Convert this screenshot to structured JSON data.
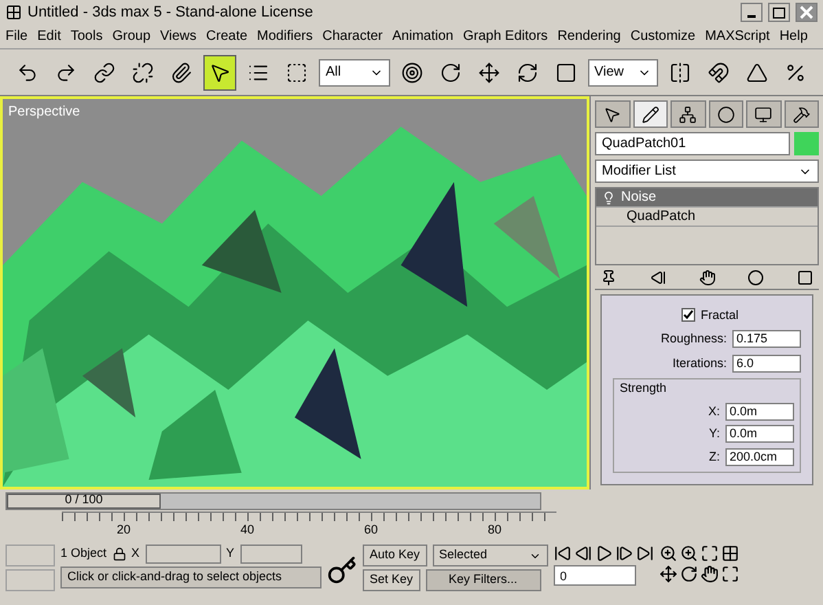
{
  "window": {
    "title": "Untitled - 3ds max 5 - Stand-alone License"
  },
  "menu": [
    "File",
    "Edit",
    "Tools",
    "Group",
    "Views",
    "Create",
    "Modifiers",
    "Character",
    "Animation",
    "Graph Editors",
    "Rendering",
    "Customize",
    "MAXScript",
    "Help"
  ],
  "toolbar": [
    {
      "kind": "icon",
      "selected": false
    },
    {
      "kind": "icon",
      "selected": false
    },
    {
      "kind": "icon",
      "selected": false
    },
    {
      "kind": "icon",
      "selected": false
    },
    {
      "kind": "icon",
      "selected": false
    },
    {
      "kind": "icon",
      "selected": true
    },
    {
      "kind": "icon",
      "selected": false
    },
    {
      "kind": "icon",
      "selected": false
    },
    {
      "kind": "dropdown",
      "value": "All"
    },
    {
      "kind": "icon",
      "selected": false
    },
    {
      "kind": "icon",
      "selected": false
    },
    {
      "kind": "icon",
      "selected": false
    },
    {
      "kind": "icon",
      "selected": false
    },
    {
      "kind": "icon",
      "selected": false
    },
    {
      "kind": "dropdown",
      "value": "View"
    },
    {
      "kind": "icon",
      "selected": false
    },
    {
      "kind": "icon",
      "selected": false
    },
    {
      "kind": "icon",
      "selected": false
    },
    {
      "kind": "icon",
      "selected": false
    }
  ],
  "viewport": {
    "label": "Perspective",
    "active": true
  },
  "command_panel": {
    "tabs": [
      {
        "selected": false
      },
      {
        "selected": true
      },
      {
        "selected": false
      },
      {
        "selected": false
      },
      {
        "selected": false
      },
      {
        "selected": false
      }
    ],
    "object_name": "QuadPatch01",
    "modifier_list": "Modifier List",
    "stack": [
      {
        "label": "Noise",
        "selected": true
      },
      {
        "label": "QuadPatch",
        "selected": false
      }
    ],
    "fractal": {
      "label": "Fractal",
      "checked": true
    },
    "params": [
      {
        "label": "Roughness:",
        "value": "0.175"
      },
      {
        "label": "Iterations:",
        "value": "6.0"
      }
    ],
    "strength": {
      "title": "Strength",
      "axes": [
        {
          "label": "X:",
          "value": "0.0m"
        },
        {
          "label": "Y:",
          "value": "0.0m"
        },
        {
          "label": "Z:",
          "value": "200.0cm"
        }
      ]
    }
  },
  "time_slider": {
    "label": "0 / 100",
    "level": 0
  },
  "ruler": [
    "20",
    "40",
    "60",
    "80"
  ],
  "status": {
    "selection": "1 Object",
    "x_label": "X",
    "y_label": "Y",
    "prompt": "Click or click-and-drag to select objects",
    "auto_key": "Auto Key",
    "key_mode": "Selected",
    "set_key": "Set Key",
    "key_filters": "Key Filters...",
    "frame": "0"
  }
}
